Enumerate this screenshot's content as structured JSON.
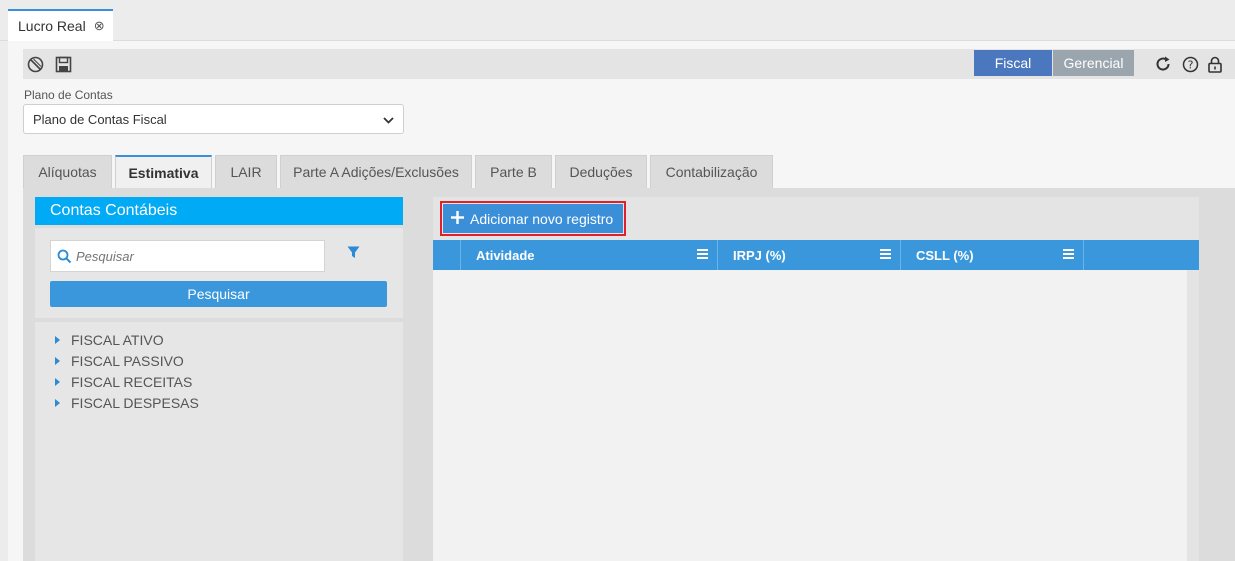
{
  "window_tab": {
    "title": "Lucro Real",
    "close_icon": "close-circle-icon"
  },
  "toolbar": {
    "left_icons": [
      "cancel-icon",
      "save-icon"
    ],
    "segments": {
      "fiscal": "Fiscal",
      "gerencial": "Gerencial"
    },
    "right_icons": [
      "refresh-icon",
      "help-icon",
      "lock-icon"
    ]
  },
  "plano": {
    "label": "Plano de Contas",
    "selected": "Plano de Contas Fiscal"
  },
  "tabs": [
    {
      "label": "Alíquotas",
      "active": false
    },
    {
      "label": "Estimativa",
      "active": true
    },
    {
      "label": "LAIR",
      "active": false
    },
    {
      "label": "Parte A Adições/Exclusões",
      "active": false
    },
    {
      "label": "Parte B",
      "active": false
    },
    {
      "label": "Deduções",
      "active": false
    },
    {
      "label": "Contabilização",
      "active": false
    }
  ],
  "contas": {
    "title": "Contas Contábeis",
    "search_placeholder": "Pesquisar",
    "search_button": "Pesquisar",
    "tree": [
      "FISCAL ATIVO",
      "FISCAL PASSIVO",
      "FISCAL RECEITAS",
      "FISCAL DESPESAS"
    ]
  },
  "grid": {
    "add_button": "Adicionar novo registro",
    "columns": [
      "Atividade",
      "IRPJ (%)",
      "CSLL (%)"
    ]
  },
  "colors": {
    "accent_blue": "#3b8fd9",
    "header_cyan": "#00aaf5",
    "highlight_red": "#e0202a",
    "segment_active": "#4a77bd",
    "segment_inactive": "#9aa5ad"
  }
}
